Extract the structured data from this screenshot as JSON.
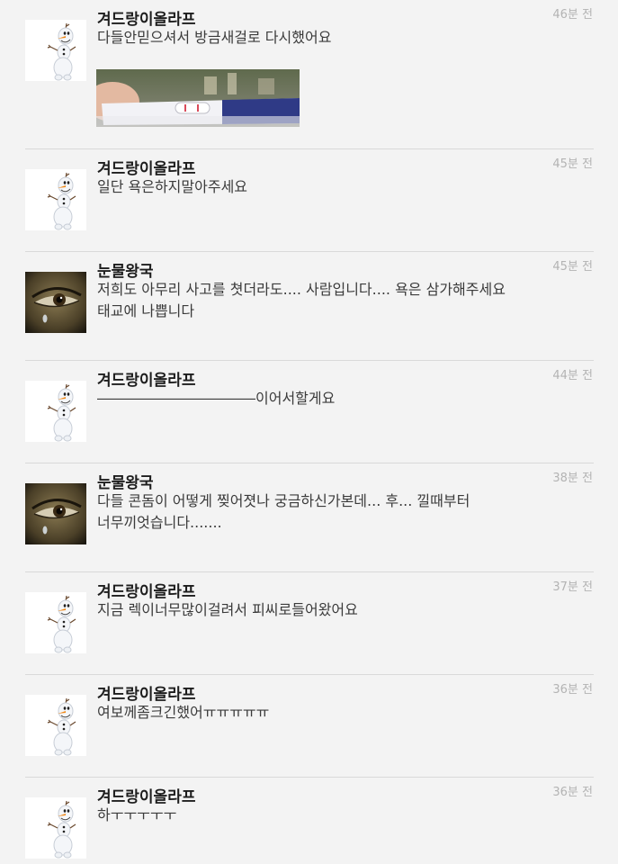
{
  "comments": [
    {
      "user": "겨드랑이올라프",
      "avatar": "olaf",
      "time": "46분 전",
      "lines": [
        "다들안믿으셔서 방금새걸로 다시했어요"
      ],
      "image": "pregnancy-test-photo"
    },
    {
      "user": "겨드랑이올라프",
      "avatar": "olaf",
      "time": "45분 전",
      "lines": [
        "일단 욕은하지말아주세요"
      ]
    },
    {
      "user": "눈물왕국",
      "avatar": "crying-eye",
      "time": "45분 전",
      "lines": [
        "저희도 아무리 사고를 쳣더라도.... 사람입니다.... 욕은 삼가해주세요",
        "태교에 나쁩니다"
      ]
    },
    {
      "user": "겨드랑이올라프",
      "avatar": "olaf",
      "time": "44분 전",
      "lines": [
        "―――――――――――이어서할게요"
      ]
    },
    {
      "user": "눈물왕국",
      "avatar": "crying-eye",
      "time": "38분 전",
      "lines": [
        "다들 콘돔이 어떻게 찢어졋나 궁금하신가본데... 후... 낄때부터",
        "너무끼엇습니다......."
      ]
    },
    {
      "user": "겨드랑이올라프",
      "avatar": "olaf",
      "time": "37분 전",
      "lines": [
        "지금 렉이너무많이걸려서 피씨로들어왔어요"
      ]
    },
    {
      "user": "겨드랑이올라프",
      "avatar": "olaf",
      "time": "36분 전",
      "lines": [
        "여보께좀크긴했어ㅠㅠㅠㅠㅠ"
      ]
    },
    {
      "user": "겨드랑이올라프",
      "avatar": "olaf",
      "time": "36분 전",
      "lines": [
        "하ㅜㅜㅜㅜㅜ"
      ]
    }
  ]
}
